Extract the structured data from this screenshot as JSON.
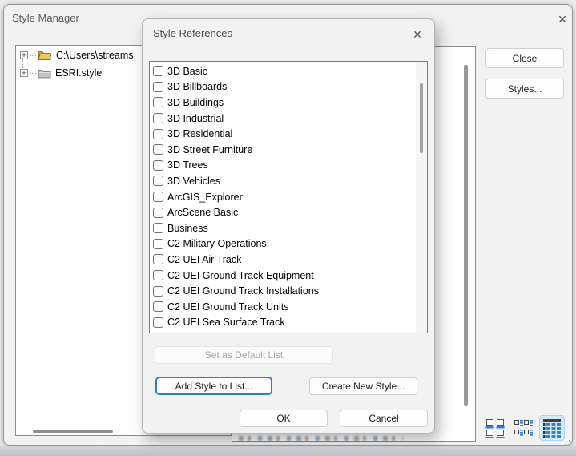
{
  "window": {
    "title": "Style Manager",
    "close_glyph": "✕",
    "tree": {
      "expand_glyph": "+",
      "items": [
        {
          "label": "C:\\Users\\streams",
          "icon": "open-folder-icon"
        },
        {
          "label": "ESRI.style",
          "icon": "closed-folder-icon"
        }
      ]
    },
    "buttons": {
      "close": "Close",
      "styles": "Styles..."
    },
    "view_modes": [
      "large-icons-view",
      "list-view",
      "details-view"
    ],
    "selected_view_mode": "details-view"
  },
  "dialog": {
    "title": "Style References",
    "close_glyph": "✕",
    "style_list": [
      "3D Basic",
      "3D Billboards",
      "3D Buildings",
      "3D Industrial",
      "3D Residential",
      "3D Street Furniture",
      "3D Trees",
      "3D Vehicles",
      "ArcGIS_Explorer",
      "ArcScene Basic",
      "Business",
      "C2 Military Operations",
      "C2 UEI Air Track",
      "C2 UEI Ground Track Equipment",
      "C2 UEI Ground Track Installations",
      "C2 UEI Ground Track Units",
      "C2 UEI Sea Surface Track"
    ],
    "buttons": {
      "set_default": {
        "label": "Set as Default List",
        "enabled": false
      },
      "add_style": {
        "label": "Add Style to List...",
        "focused": true
      },
      "create_new": {
        "label": "Create New Style..."
      },
      "ok": {
        "label": "OK"
      },
      "cancel": {
        "label": "Cancel"
      }
    }
  },
  "colors": {
    "focus_border": "#2b7cd3",
    "selected_view_bg": "#d7ecfb",
    "selected_view_border": "#a9d3f1",
    "folder_yellow": "#e8c665",
    "icon_blue": "#2f7fd6",
    "window_bg": "#f2f2f2"
  }
}
